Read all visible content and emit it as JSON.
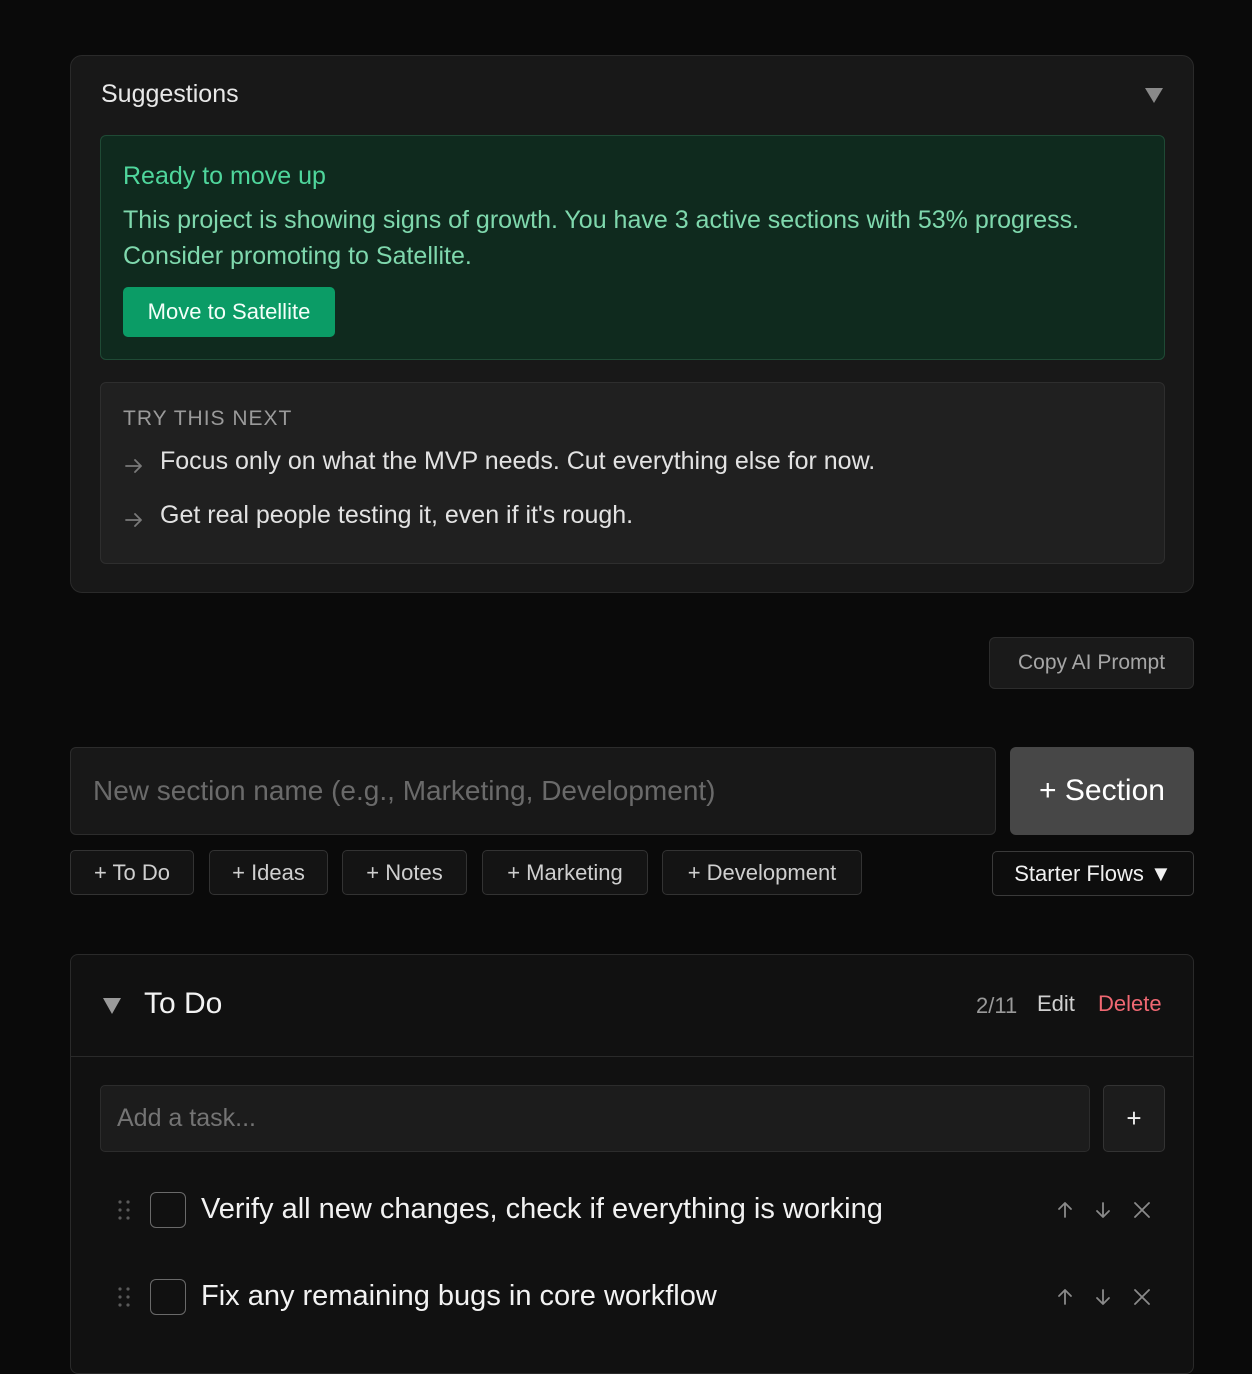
{
  "suggestions": {
    "title": "Suggestions",
    "promotion": {
      "title": "Ready to move up",
      "text": "This project is showing signs of growth. You have 3 active sections with 53% progress. Consider promoting to Satellite.",
      "button": "Move to Satellite"
    },
    "next": {
      "heading": "TRY THIS NEXT",
      "items": [
        "Focus only on what the MVP needs. Cut everything else for now.",
        "Get real people testing it, even if it's rough."
      ]
    }
  },
  "toolbar": {
    "copy_prompt": "Copy AI Prompt"
  },
  "new_section": {
    "placeholder": "New section name (e.g., Marketing, Development)",
    "button": "+ Section",
    "chips": [
      "+ To Do",
      "+ Ideas",
      "+ Notes",
      "+ Marketing",
      "+ Development"
    ],
    "starter_flows": "Starter Flows ▼"
  },
  "section": {
    "title": "To Do",
    "count": "2/11",
    "edit": "Edit",
    "delete": "Delete",
    "task_placeholder": "Add a task...",
    "add_button": "+",
    "tasks": [
      "Verify all new changes, check if everything is working",
      "Fix any remaining bugs in core workflow"
    ]
  },
  "colors": {
    "accent_green": "#0b9c66",
    "danger": "#f06872",
    "background": "#0a0a0a"
  },
  "icons": {
    "collapse": "triangle-down-icon",
    "arrow": "arrow-right-icon",
    "drag": "drag-handle-icon",
    "up": "arrow-up-icon",
    "down": "arrow-down-icon",
    "remove": "close-icon"
  }
}
